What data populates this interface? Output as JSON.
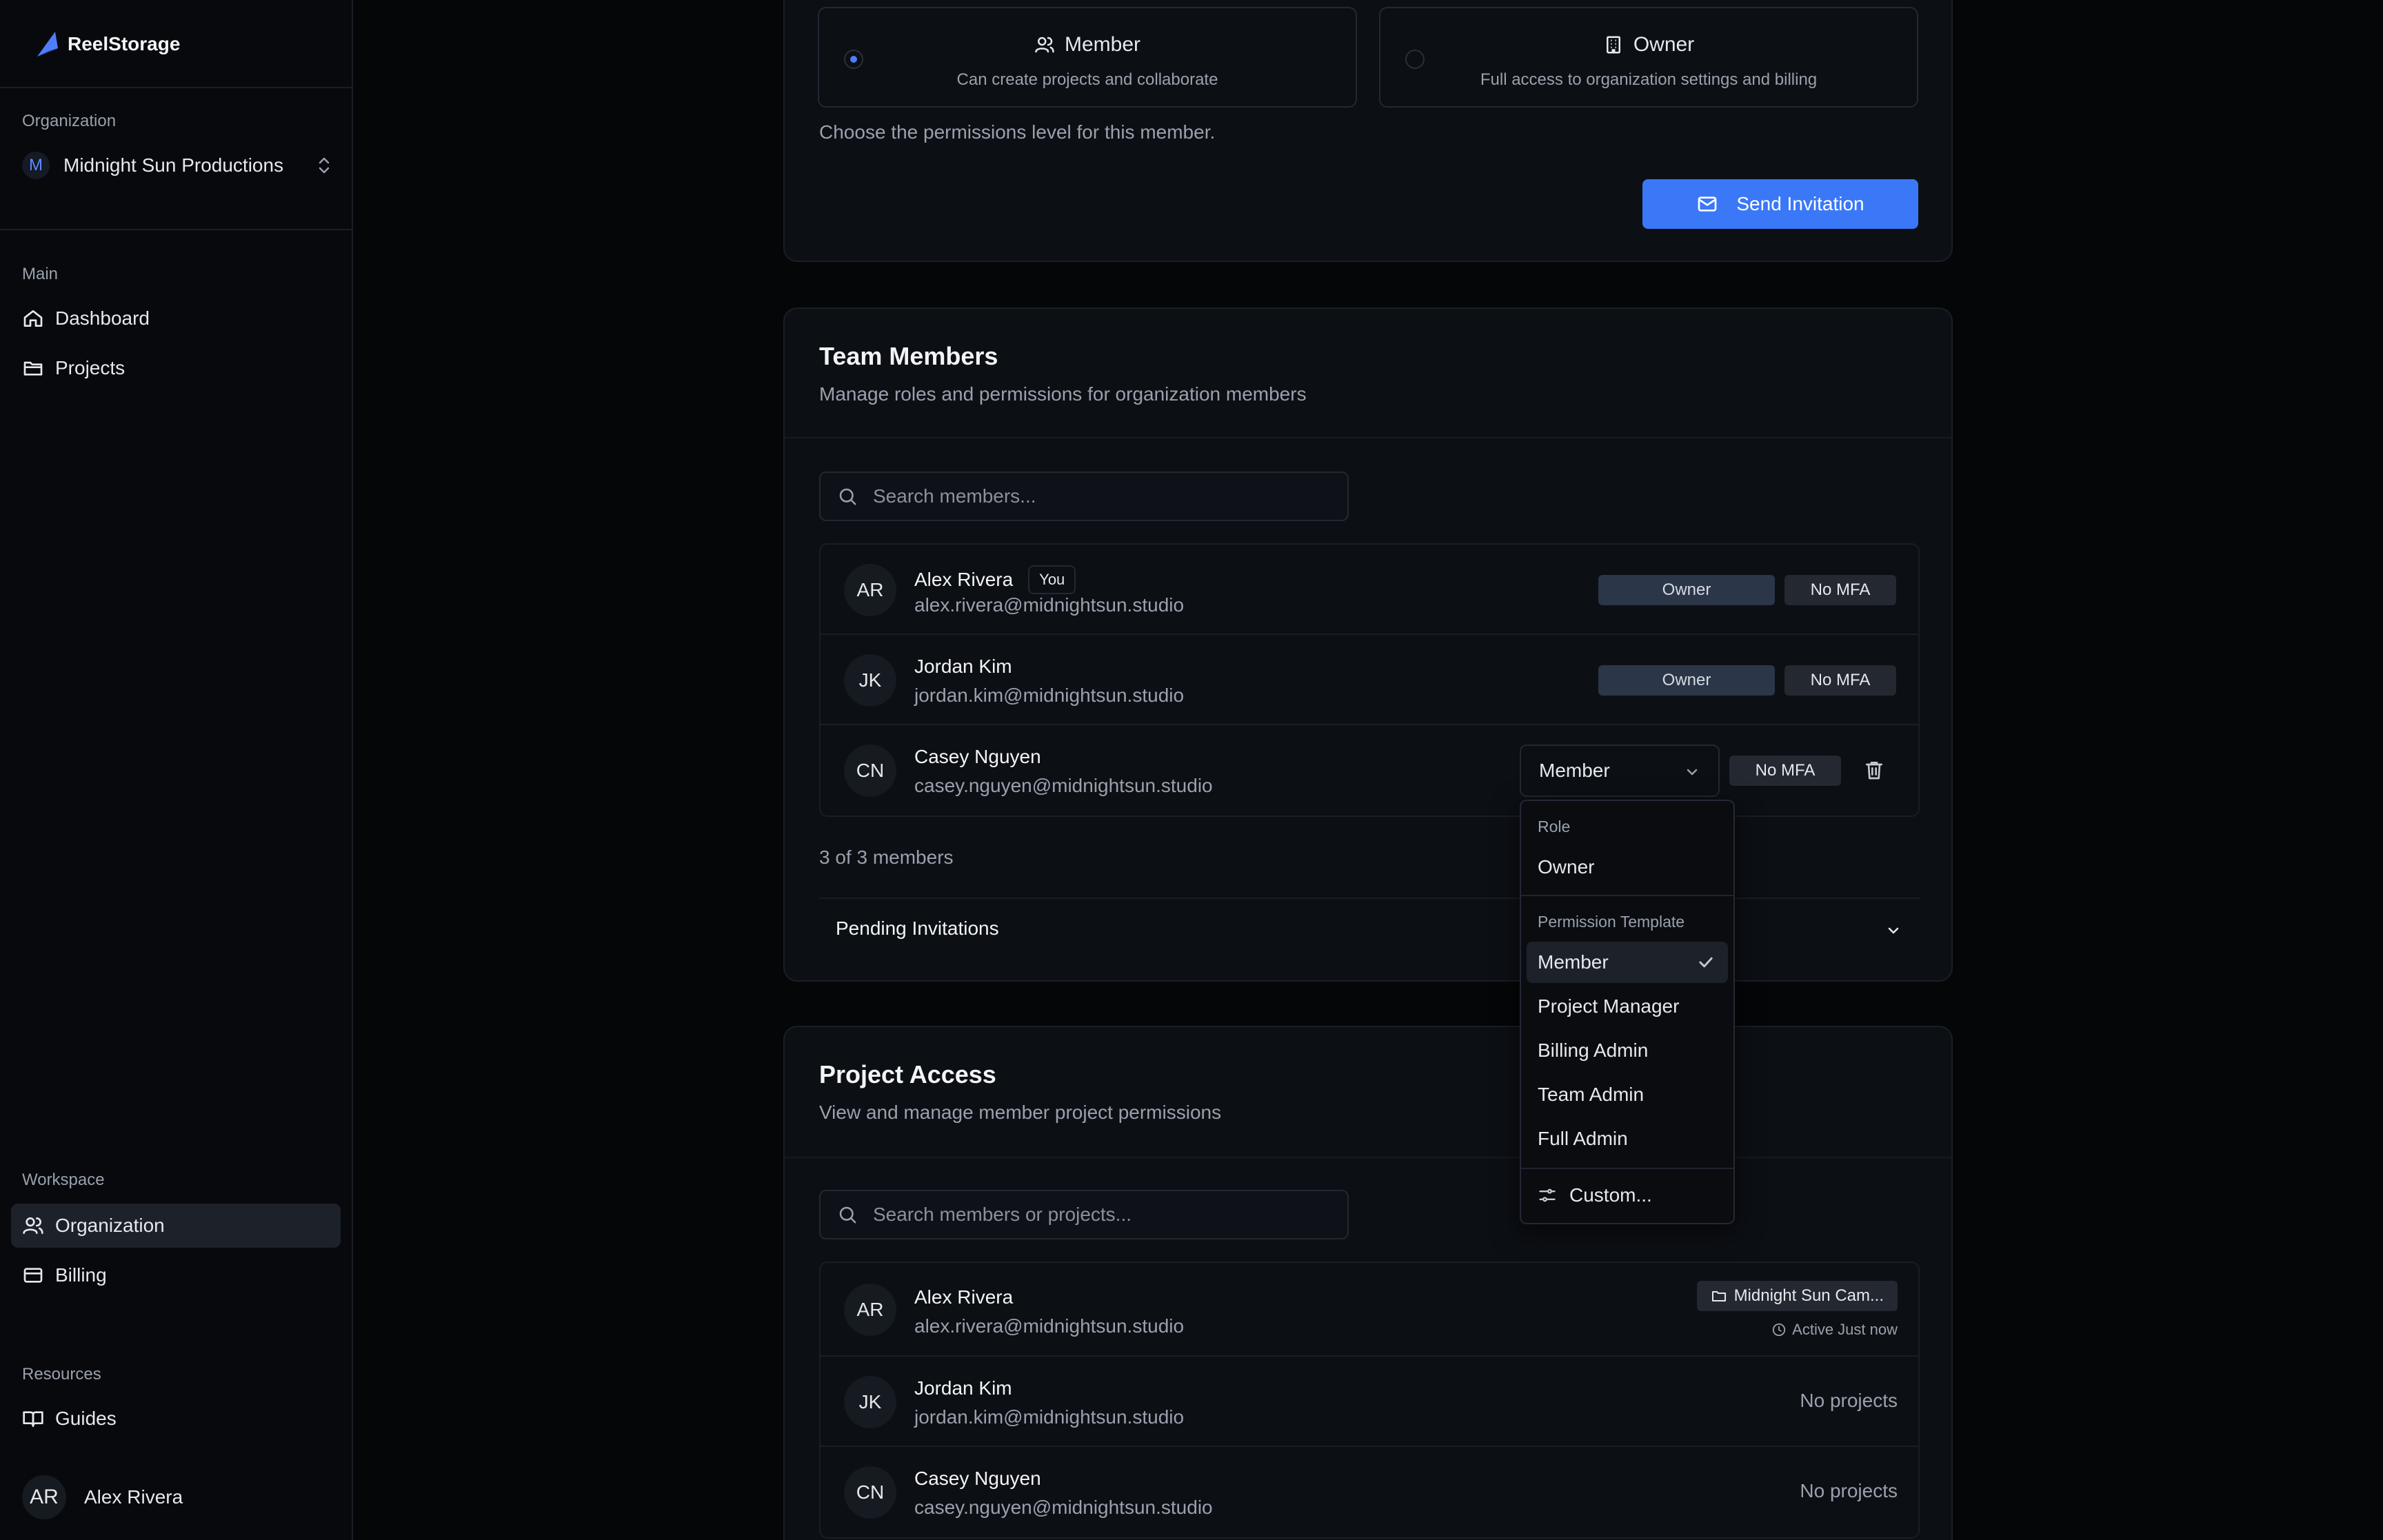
{
  "app": {
    "name": "ReelStorage"
  },
  "sidebar": {
    "organization_label": "Organization",
    "organization_badge": "M",
    "organization_name": "Midnight Sun Productions",
    "main_label": "Main",
    "main_items": [
      {
        "label": "Dashboard",
        "icon": "home-icon"
      },
      {
        "label": "Projects",
        "icon": "folder-icon"
      }
    ],
    "workspace_label": "Workspace",
    "workspace_items": [
      {
        "label": "Organization",
        "icon": "users-icon",
        "active": true
      },
      {
        "label": "Billing",
        "icon": "credit-card-icon"
      }
    ],
    "resources_label": "Resources",
    "resources_items": [
      {
        "label": "Guides",
        "icon": "book-icon"
      }
    ],
    "user": {
      "initials": "AR",
      "name": "Alex Rivera"
    }
  },
  "invite": {
    "roles": [
      {
        "title": "Member",
        "description": "Can create projects and collaborate",
        "selected": true,
        "icon": "users-icon"
      },
      {
        "title": "Owner",
        "description": "Full access to organization settings and billing",
        "selected": false,
        "icon": "building-icon"
      }
    ],
    "hint": "Choose the permissions level for this member.",
    "send_label": "Send Invitation"
  },
  "team": {
    "title": "Team Members",
    "subtitle": "Manage roles and permissions for organization members",
    "search_placeholder": "Search members...",
    "members": [
      {
        "initials": "AR",
        "name": "Alex Rivera",
        "you": "You",
        "email": "alex.rivera@midnightsun.studio",
        "role": "Owner",
        "mfa": "No MFA"
      },
      {
        "initials": "JK",
        "name": "Jordan Kim",
        "email": "jordan.kim@midnightsun.studio",
        "role": "Owner",
        "mfa": "No MFA"
      },
      {
        "initials": "CN",
        "name": "Casey Nguyen",
        "email": "casey.nguyen@midnightsun.studio",
        "role": "Member",
        "mfa": "No MFA"
      }
    ],
    "count_text": "3 of 3 members",
    "pending_label": "Pending Invitations"
  },
  "project_access": {
    "title": "Project Access",
    "subtitle": "View and manage member project permissions",
    "search_placeholder": "Search members or projects...",
    "rows": [
      {
        "initials": "AR",
        "name": "Alex Rivera",
        "email": "alex.rivera@midnightsun.studio",
        "project": "Midnight Sun Cam...",
        "active": "Active Just now"
      },
      {
        "initials": "JK",
        "name": "Jordan Kim",
        "email": "jordan.kim@midnightsun.studio",
        "status": "No projects"
      },
      {
        "initials": "CN",
        "name": "Casey Nguyen",
        "email": "casey.nguyen@midnightsun.studio",
        "status": "No projects"
      }
    ]
  },
  "role_dropdown": {
    "role_label": "Role",
    "role_items": [
      "Owner"
    ],
    "template_label": "Permission Template",
    "template_items": [
      "Member",
      "Project Manager",
      "Billing Admin",
      "Team Admin",
      "Full Admin"
    ],
    "selected": "Member",
    "custom_label": "Custom..."
  },
  "colors": {
    "accent": "#3b78f7",
    "background": "#050608",
    "card": "#0c0f14",
    "owner_pill": "#2b3648"
  }
}
